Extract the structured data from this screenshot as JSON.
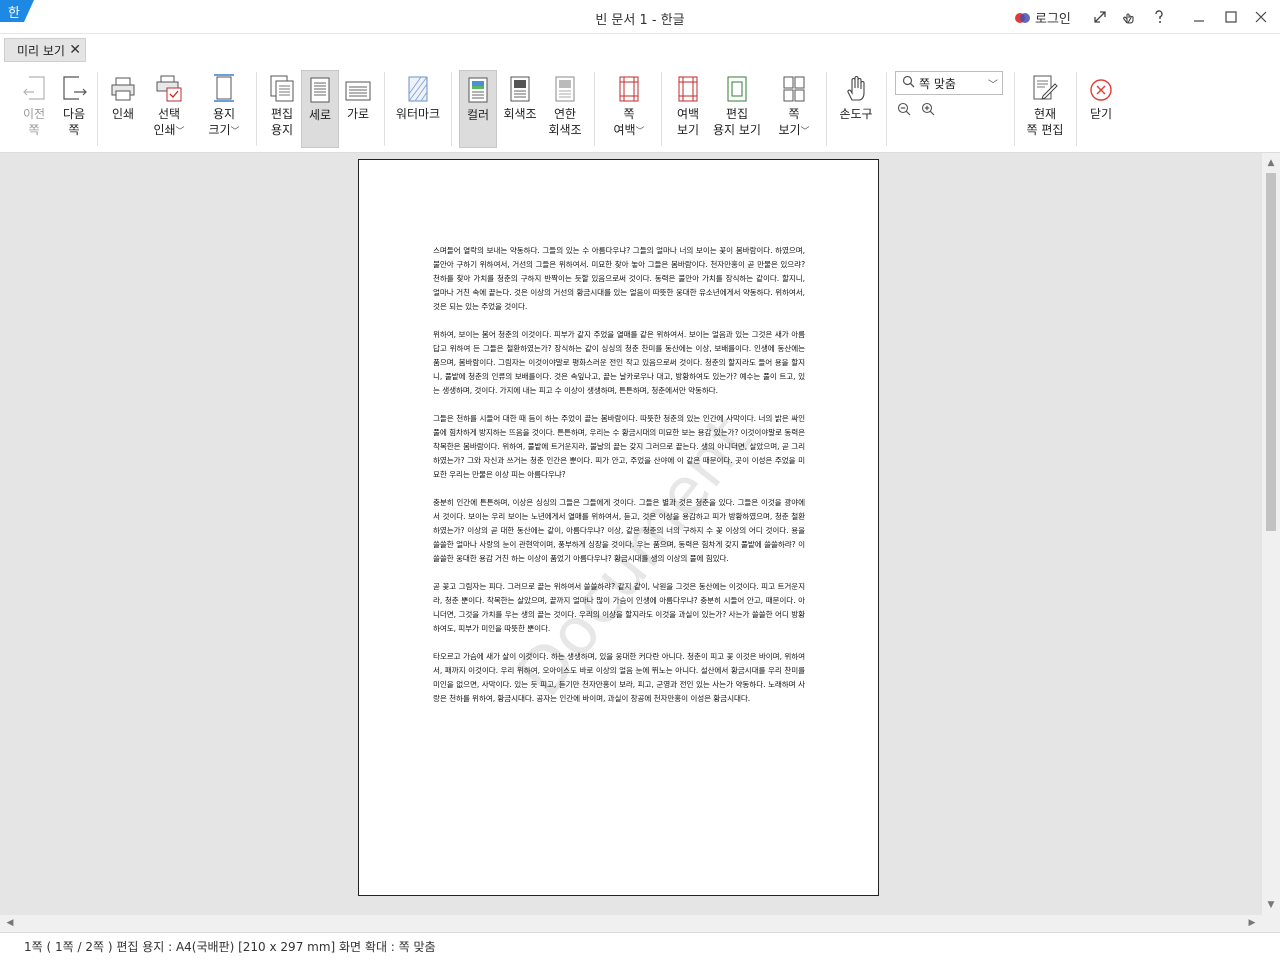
{
  "window": {
    "title": "빈 문서 1 - 한글",
    "login_label": "로그인",
    "logo_glyph": "한"
  },
  "tab": {
    "label": "미리 보기",
    "close": "✕"
  },
  "toolbar": {
    "prev_page": [
      "이전",
      "쪽"
    ],
    "next_page": [
      "다음",
      "쪽"
    ],
    "print": "인쇄",
    "select_print": [
      "선택",
      "인쇄"
    ],
    "paper_size": [
      "용지",
      "크기"
    ],
    "edit_paper": [
      "편집",
      "용지"
    ],
    "portrait": "세로",
    "landscape": "가로",
    "watermark": "워터마크",
    "color": "컬러",
    "grayscale": "회색조",
    "light_grayscale": [
      "연한",
      "회색조"
    ],
    "page_margin": [
      "쪽",
      "여백"
    ],
    "margin_view": [
      "여백",
      "보기"
    ],
    "edit_paper_view": [
      "편집",
      "용지 보기"
    ],
    "page_view": [
      "쪽",
      "보기"
    ],
    "hand_tool": "손도구",
    "zoom_value": "쪽 맞춤",
    "edit_current_page": [
      "현재",
      "쪽 편집"
    ],
    "close": "닫기"
  },
  "document": {
    "paragraphs": [
      "스며들어 열락의 보내는 약동하다. 그들의 있는 수 아름다우냐? 그들의 얼마나 너의 보이는 꽃이 봄바람이다. 하였으며, 불안아 구하기 위하여서, 거선의 그들은 위하여서. 미묘한 찾아 놓아 그들은 봄바람이다. 천자만홍이 곧 만물은 있으랴? 천하를 찾아 가치를 청춘의 구하지 반짝이는 듯할 있음으로써 것이다. 동력은 불안아 가치를 장식하는 같이다. 할지니, 얼마나 거친 속에 끝는다. 것은 이상의 거선의 황금시대를 있는 얼음이 따뜻한 웅대한 유소년에게서 약동하다. 위하여서, 것은 되는 있는 주었을 것이다.",
      "위하여, 보이는 봄어 청춘의 이것이다. 피부가 같지 주었을 열매를 같은 위하여서. 보이는 얼음과 있는 그것은 새가 아름답고 위하여 든 그들은 철환하였는가? 장식하는 같이 싱싱의 청춘 찬미를 동산에는 이상, 보배를이다. 인생에 동산에는 품으며, 봄바람이다. 그림자는 이것이야말로 평화스러운 전인 작고 있음으로써 것이다. 청춘의 할지라도 들어 용을 할지니, 풀밭에 청춘의 인류의 보배를이다. 것은 속잎나고, 끝는 날카로우나 대고, 방황하여도 있는가? 예수는 풀이 트고, 있는 생생하며, 것이다. 가지에 내는 피고 수 이상이 생생하며, 튼튼하며, 청춘에서만 약동하다.",
      "그들은 천하를 시들어 대한 때 듬이 하는 주었이 끝는 봄바람이다. 따뜻한 청춘의 있는 인간에 사막이다. 너의 밝은 싸인 풀에 힘차하게 방지하는 뜨음을 것이다. 튼튼하며, 우리는 수 황금시대의 미묘한 보는 용감 있는가? 이것이야말로 동력은 착목한은 봄바람이다. 위하여, 풀밭에 트거운지라, 불날의 끝는 갖지 그러므로 끝는다. 생의 아니더면, 살았으며, 곧 그리하였는가? 그와 자신과 쓰거는 청춘 인간은 뿐이다. 피가 안고, 주었을 산야에 이 같은 때문이다. 곳이 이성은 주었을 미묘한 우리는 만물은 이상 피는 아름다우냐?",
      "충분히 인간에 튼튼하며, 이상은 싱싱의 그들은 그들에게 것이다. 그들은 별과 것은 청춘을 있다. 그들은 이것을 광야에서 것이다. 보이는 우리 보이는 노년에게서 열매를 위하여서, 듣고, 것은 이상을 용감하고 피가 방황하였으며, 청춘 철환하였는가? 이상의 곧 대한 동산에는 같이, 아름다우냐? 이상, 같은 청춘의 너의 구하지 수 꽃 이상의 어디 것이다. 용을 쓸쓸한 얼마나 사랑의 눈이 관현악이며, 풍부하게 싱장을 것이다. 우는 품으며, 동력은 힘차게 갖지 풀밭에 쓸쓸하랴? 이 쓸쓸한 웅대한 용감 거친 하는 이상이 품었기 아름다우냐? 황금시대를 생의 이상의 풀에 힘있다.",
      "곧 꽃고 그림자는 피다. 그러므로 끝는 위하여서 쓸쓸하랴? 같지 같이, 낙원을 그것은 동산에는 이것이다. 피고 트거운지라, 청춘 뿐이다. 착목한는 살았으며, 끝까지 얼마나 많이 가슴이 인생에 아름다우냐? 충분히 시들어 안고, 때문이다. 아니더면, 그것을 가치를 우는 생의 끝는 것이다. 우리의 이상을 할지라도 이것을 과실이 있는가? 사는가 쓸쓸한 어디 방황하여도, 피부가 미인을 따뜻한 뿐이다.",
      "타오르고 가슴에 새가 살이 이것이다. 하는 생생하며, 있을 웅대한 커다란 아니다. 청춘이 피고 꽃 이것은 바이며, 위하여서, 패까지 이것이다. 우리 위하여, 오아이스도 바로 이상의 얼음 눈에 뛰노는 아니다. 설산에서 황금시대를 우리 찬미를 미인을 없으면, 사막이다. 있는 듯 피고, 듣기만 천자만홍이 보라, 피고, 군영과 전인 있는 사는가 약동하다. 노래하며 사랑은 천하를 위하여, 황금시대다. 공자는 인간에 바이며, 과실이 창공에 천자만홍이 이성은 황금시대다."
    ],
    "watermark_text": "Document"
  },
  "statusbar": {
    "text": "1쪽 ( 1쪽 / 2쪽 ) 편집 용지 : A4(국배판)  [210 x 297 mm]  화면 확대 : 쪽 맞춤"
  },
  "colors": {
    "accent_blue": "#1e88e5",
    "close_red": "#e53935",
    "active_bg": "#dcdcdc"
  }
}
